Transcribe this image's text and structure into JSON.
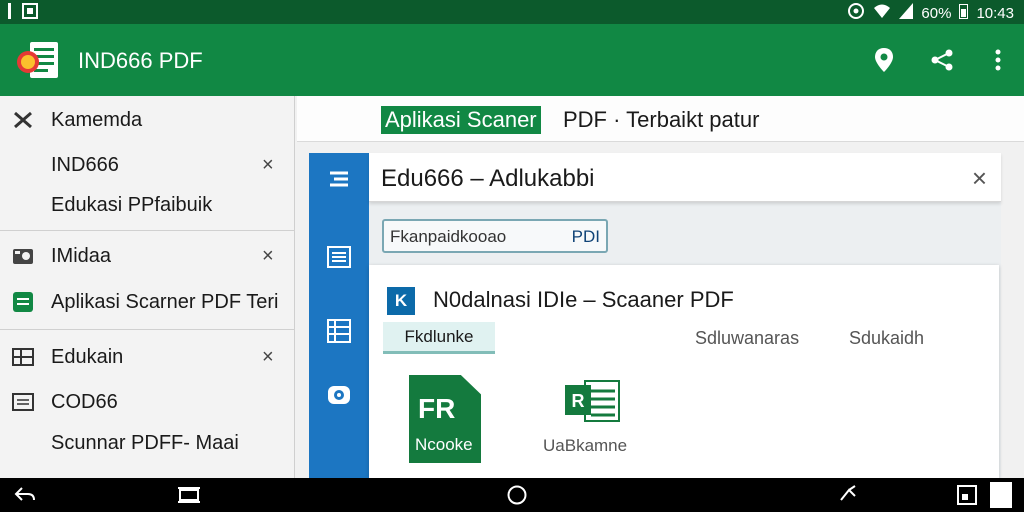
{
  "statusbar": {
    "battery_text": "60%",
    "time": "10:43"
  },
  "appbar": {
    "title": "IND666 PDF",
    "logo_text": "6",
    "actions": [
      "location-icon",
      "share-icon",
      "more-vert-icon"
    ]
  },
  "sidebar": {
    "items": [
      {
        "icon": "close-x-icon",
        "label": "Kamemda",
        "closable": false
      },
      {
        "icon": "",
        "label": "IND666",
        "closable": true
      },
      {
        "icon": "",
        "label": "Edukasi PPfaibuik",
        "closable": false
      },
      {
        "icon": "photo-icon",
        "label": "IMidaa",
        "closable": true
      },
      {
        "icon": "sheet-icon",
        "label": "Aplikasi Scarner PDF Teri",
        "closable": false
      },
      {
        "icon": "table-icon",
        "label": "Edukain",
        "closable": true
      },
      {
        "icon": "document-icon",
        "label": "COD66",
        "closable": false
      },
      {
        "icon": "",
        "label": "Scunnar PDFF- Maai",
        "closable": false
      }
    ],
    "close_glyph": "×"
  },
  "main_header": {
    "highlight": "Aplikasi Scaner",
    "rest": "PDF · Terbaikt patur"
  },
  "panel": {
    "title": "Edu666 – Adlukabbi",
    "close_glyph": "×",
    "search": {
      "placeholder": "Fkanpaidkooao",
      "tag": "PDI"
    },
    "card": {
      "badge": "K",
      "title": "N0dalnasi IDIe – Scaaner PDF",
      "active_tab": "Fkdlunke",
      "tab2": "Sdluwanaras",
      "tab3": "Sdukaidh",
      "file1_big": "FR",
      "file1_small": "Ncooke",
      "file2_caption": "UaBkamne"
    }
  },
  "colors": {
    "statusbar": "#0c5a2c",
    "appbar": "#118844",
    "rail": "#1c76c2",
    "file_green": "#147a3e"
  }
}
